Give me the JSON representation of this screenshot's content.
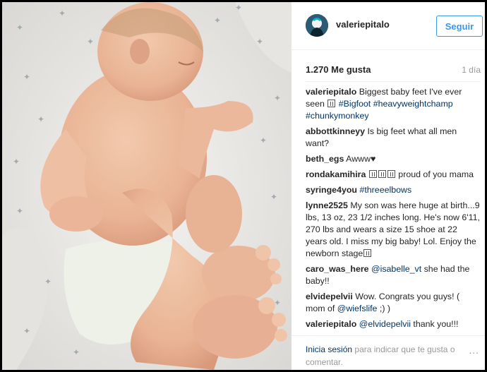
{
  "post": {
    "owner": "valeriepitalo",
    "follow_label": "Seguir",
    "likes": "1.270 Me gusta",
    "time": "1 día"
  },
  "caption": {
    "user": "valeriepitalo",
    "text": "Biggest baby feet I've ever seen",
    "tags": [
      "#Bigfoot",
      "#heavyweightchamp",
      "#chunkymonkey"
    ]
  },
  "comments": [
    {
      "user": "abbottkinneyy",
      "text": "Is big feet what all men want?"
    },
    {
      "user": "beth_egs",
      "text": "Awww♥"
    },
    {
      "user": "rondakamihira",
      "text": "proud of you mama"
    },
    {
      "user": "syringe4you",
      "tag": "#threeelbows"
    },
    {
      "user": "lynne2525",
      "text": "My son was here huge at birth...9 lbs, 13 oz, 23 1/2 inches long. He's now 6'11, 270 lbs and wears a size 15 shoe at 22 years old. I miss my big baby! Lol. Enjoy the newborn stage"
    },
    {
      "user": "caro_was_here",
      "mention": "@isabelle_vt",
      "text": "she had the baby!!"
    },
    {
      "user": "elvidepelvii",
      "text": "Wow. Congrats you guys! ( mom of",
      "mention": "@wiefslife",
      "text_after": ";) )"
    },
    {
      "user": "valeriepitalo",
      "mention": "@elvidepelvii",
      "text": "thank you!!!"
    }
  ],
  "footer": {
    "login_link": "Inicia sesión",
    "login_text": "para indicar que te gusta o comentar.",
    "more": "..."
  },
  "icons": [
    "avatar",
    "more-options-icon",
    "emoji-box-icon",
    "heart-icon"
  ],
  "colors": {
    "link": "#003569",
    "follow": "#3897f0",
    "muted": "#999999"
  }
}
